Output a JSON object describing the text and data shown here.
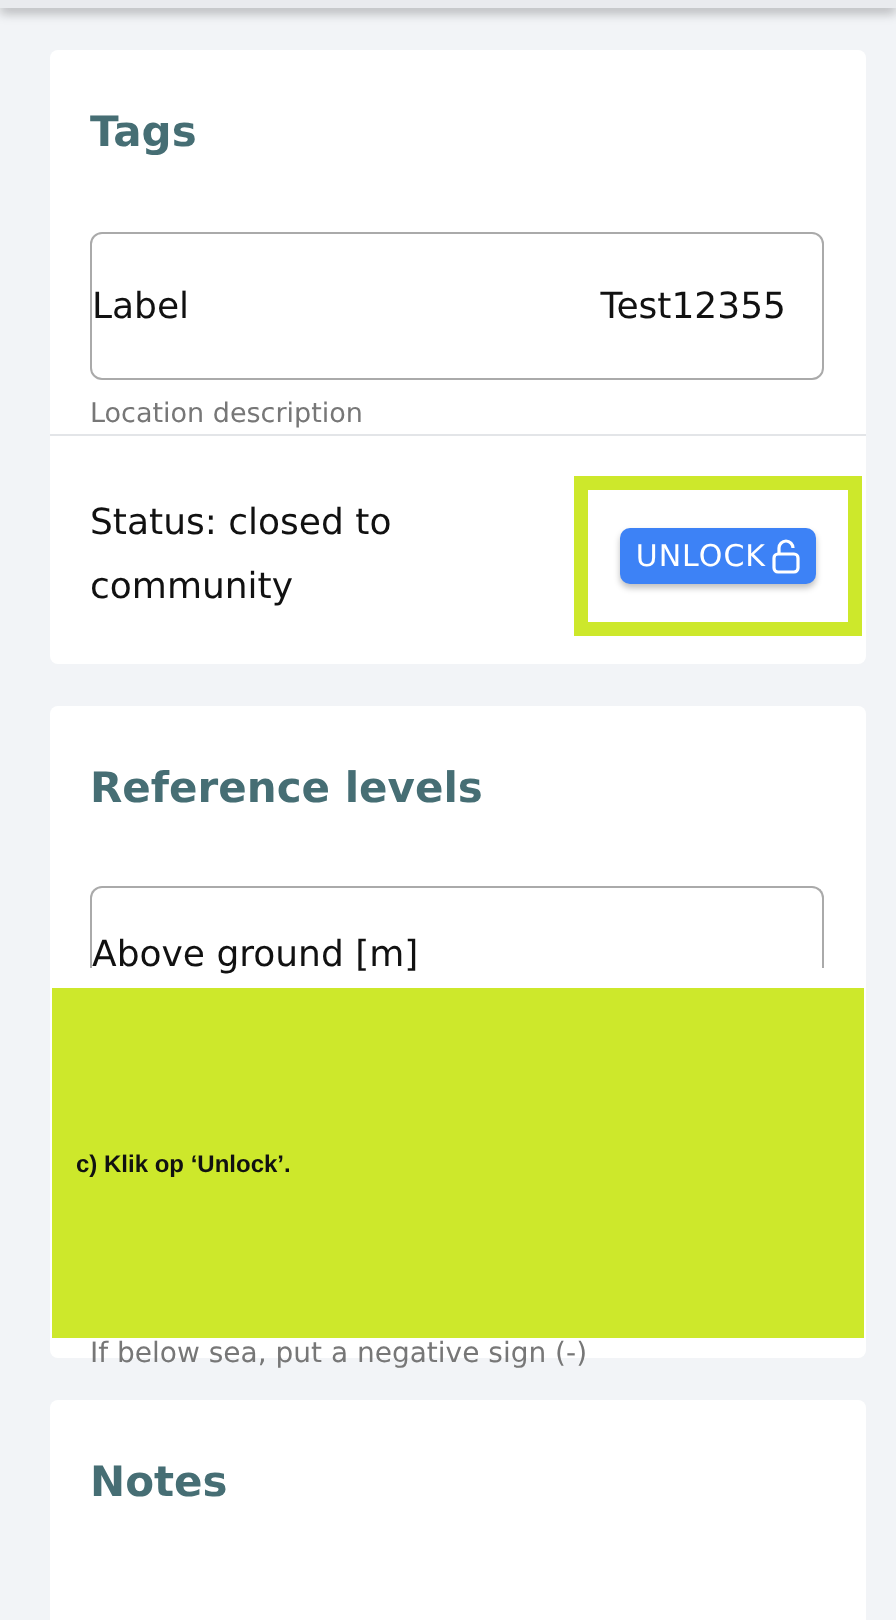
{
  "tags_card": {
    "title": "Tags",
    "field": {
      "label": "Label",
      "value": "Test12355"
    },
    "helper": "Location description",
    "status": "Status: closed to community",
    "button": "UNLOCK",
    "highlighted": true
  },
  "reference_card": {
    "title": "Reference levels",
    "field": {
      "label": "Above ground [m]"
    },
    "hint": "If below sea, put a negative sign (-)"
  },
  "notes_card": {
    "title": "Notes"
  },
  "annotation": {
    "text": "c) Klik op ‘Unlock’."
  }
}
